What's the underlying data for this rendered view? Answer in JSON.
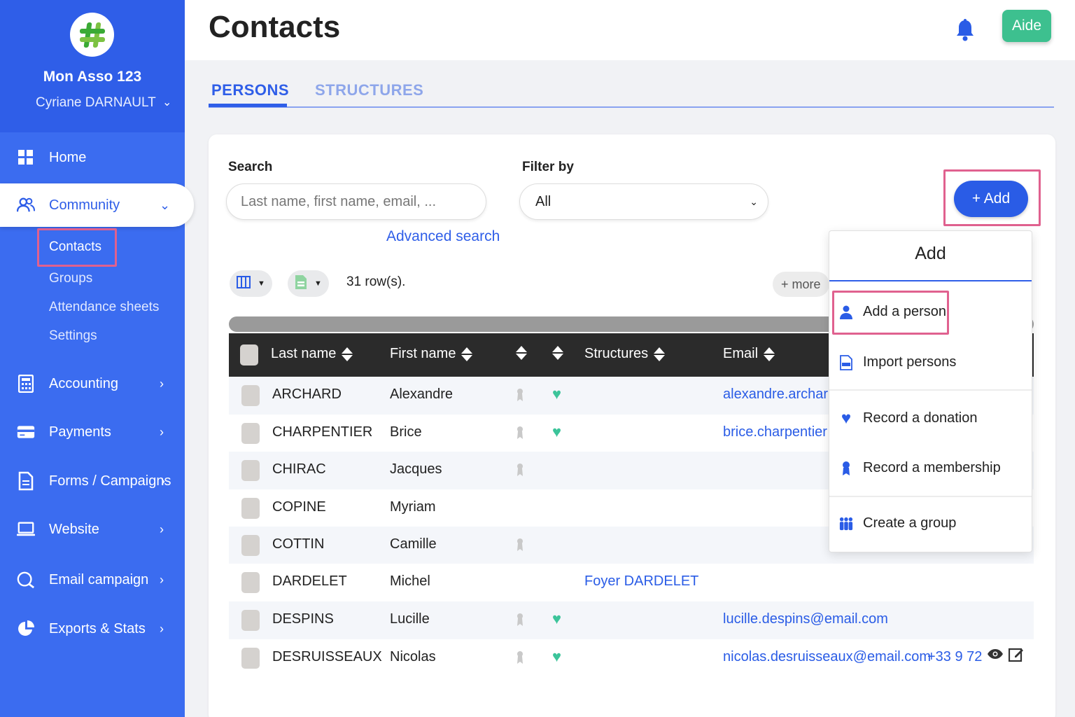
{
  "sidebar": {
    "org_name": "Mon Asso 123",
    "user_name": "Cyriane DARNAULT",
    "nav": [
      {
        "label": "Home",
        "icon": "grid-icon"
      },
      {
        "label": "Community",
        "icon": "users-icon"
      },
      {
        "label": "Accounting",
        "icon": "calculator-icon"
      },
      {
        "label": "Payments",
        "icon": "credit-card-icon"
      },
      {
        "label": "Forms / Campaigns",
        "icon": "document-icon"
      },
      {
        "label": "Website",
        "icon": "laptop-icon"
      },
      {
        "label": "Email campaign",
        "icon": "chat-icon"
      },
      {
        "label": "Exports & Stats",
        "icon": "pie-chart-icon"
      }
    ],
    "community_sub": [
      "Contacts",
      "Groups",
      "Attendance sheets",
      "Settings"
    ]
  },
  "header": {
    "title": "Contacts",
    "help_label": "Aide"
  },
  "tabs": [
    {
      "label": "PERSONS",
      "active": true
    },
    {
      "label": "STRUCTURES",
      "active": false
    }
  ],
  "filters": {
    "search_label": "Search",
    "search_placeholder": "Last name, first name, email, ...",
    "filter_label": "Filter by",
    "filter_value": "All",
    "advanced_search": "Advanced search",
    "add_button": "+ Add",
    "row_count": "31 row(s).",
    "more_button": "+ more"
  },
  "table": {
    "headers": [
      "Last name",
      "First name",
      "Structures",
      "Email"
    ],
    "rows": [
      {
        "last": "ARCHARD",
        "first": "Alexandre",
        "member": true,
        "donor": true,
        "structure": "",
        "email": "alexandre.archard",
        "phone": ""
      },
      {
        "last": "CHARPENTIER",
        "first": "Brice",
        "member": true,
        "donor": true,
        "structure": "",
        "email": "brice.charpentier",
        "phone": ""
      },
      {
        "last": "CHIRAC",
        "first": "Jacques",
        "member": true,
        "donor": false,
        "structure": "",
        "email": "",
        "phone": ""
      },
      {
        "last": "COPINE",
        "first": "Myriam",
        "member": false,
        "donor": false,
        "structure": "",
        "email": "",
        "phone": ""
      },
      {
        "last": "COTTIN",
        "first": "Camille",
        "member": true,
        "donor": false,
        "structure": "",
        "email": "",
        "phone": ""
      },
      {
        "last": "DARDELET",
        "first": "Michel",
        "member": false,
        "donor": false,
        "structure": "Foyer DARDELET",
        "email": "",
        "phone": ""
      },
      {
        "last": "DESPINS",
        "first": "Lucille",
        "member": true,
        "donor": true,
        "structure": "",
        "email": "lucille.despins@email.com",
        "phone": ""
      },
      {
        "last": "DESRUISSEAUX",
        "first": "Nicolas",
        "member": true,
        "donor": true,
        "structure": "",
        "email": "nicolas.desruisseaux@email.com",
        "phone": "+33 9 72"
      }
    ]
  },
  "dropdown": {
    "title": "Add",
    "items": [
      {
        "label": "Add a person",
        "icon": "person-icon"
      },
      {
        "label": "Import persons",
        "icon": "import-file-icon"
      },
      {
        "label": "Record a donation",
        "icon": "heart-icon"
      },
      {
        "label": "Record a membership",
        "icon": "ribbon-icon"
      },
      {
        "label": "Create a group",
        "icon": "group-icon"
      }
    ]
  },
  "colors": {
    "sidebar": "#3b6cf0",
    "primary": "#2a5ce6",
    "help": "#3dc08f",
    "highlight": "#e0618f",
    "donor_heart": "#3cc49a"
  }
}
